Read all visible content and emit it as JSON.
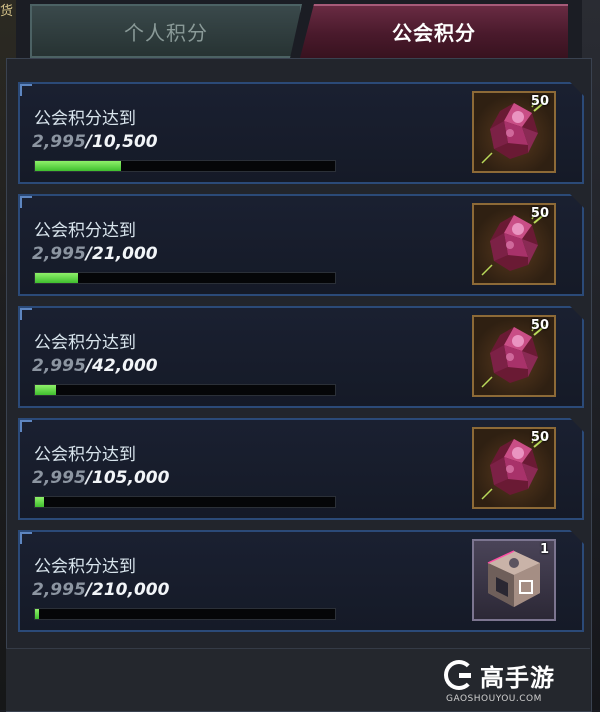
{
  "tabs": [
    {
      "label": "个人积分",
      "active": false
    },
    {
      "label": "公会积分",
      "active": true
    }
  ],
  "background_glyph": "货",
  "rows": [
    {
      "title": "公会积分达到",
      "current": "2,995",
      "separator": "/",
      "goal": "10,500",
      "progress": 0.285,
      "reward": {
        "icon": "crystal-icon",
        "qty": "50"
      }
    },
    {
      "title": "公会积分达到",
      "current": "2,995",
      "separator": "/",
      "goal": "21,000",
      "progress": 0.143,
      "reward": {
        "icon": "crystal-icon",
        "qty": "50"
      }
    },
    {
      "title": "公会积分达到",
      "current": "2,995",
      "separator": "/",
      "goal": "42,000",
      "progress": 0.071,
      "reward": {
        "icon": "crystal-icon",
        "qty": "50"
      }
    },
    {
      "title": "公会积分达到",
      "current": "2,995",
      "separator": "/",
      "goal": "105,000",
      "progress": 0.029,
      "reward": {
        "icon": "crystal-icon",
        "qty": "50"
      }
    },
    {
      "title": "公会积分达到",
      "current": "2,995",
      "separator": "/",
      "goal": "210,000",
      "progress": 0.014,
      "reward": {
        "icon": "cube-box-icon",
        "qty": "1"
      }
    }
  ],
  "watermark": {
    "name": "高手游",
    "site": "GAOSHOUYOU.COM"
  },
  "colors": {
    "accent_active_tab": "#6b2c44",
    "progress_fill": "#5fd845",
    "row_border": "#2b4a78"
  }
}
